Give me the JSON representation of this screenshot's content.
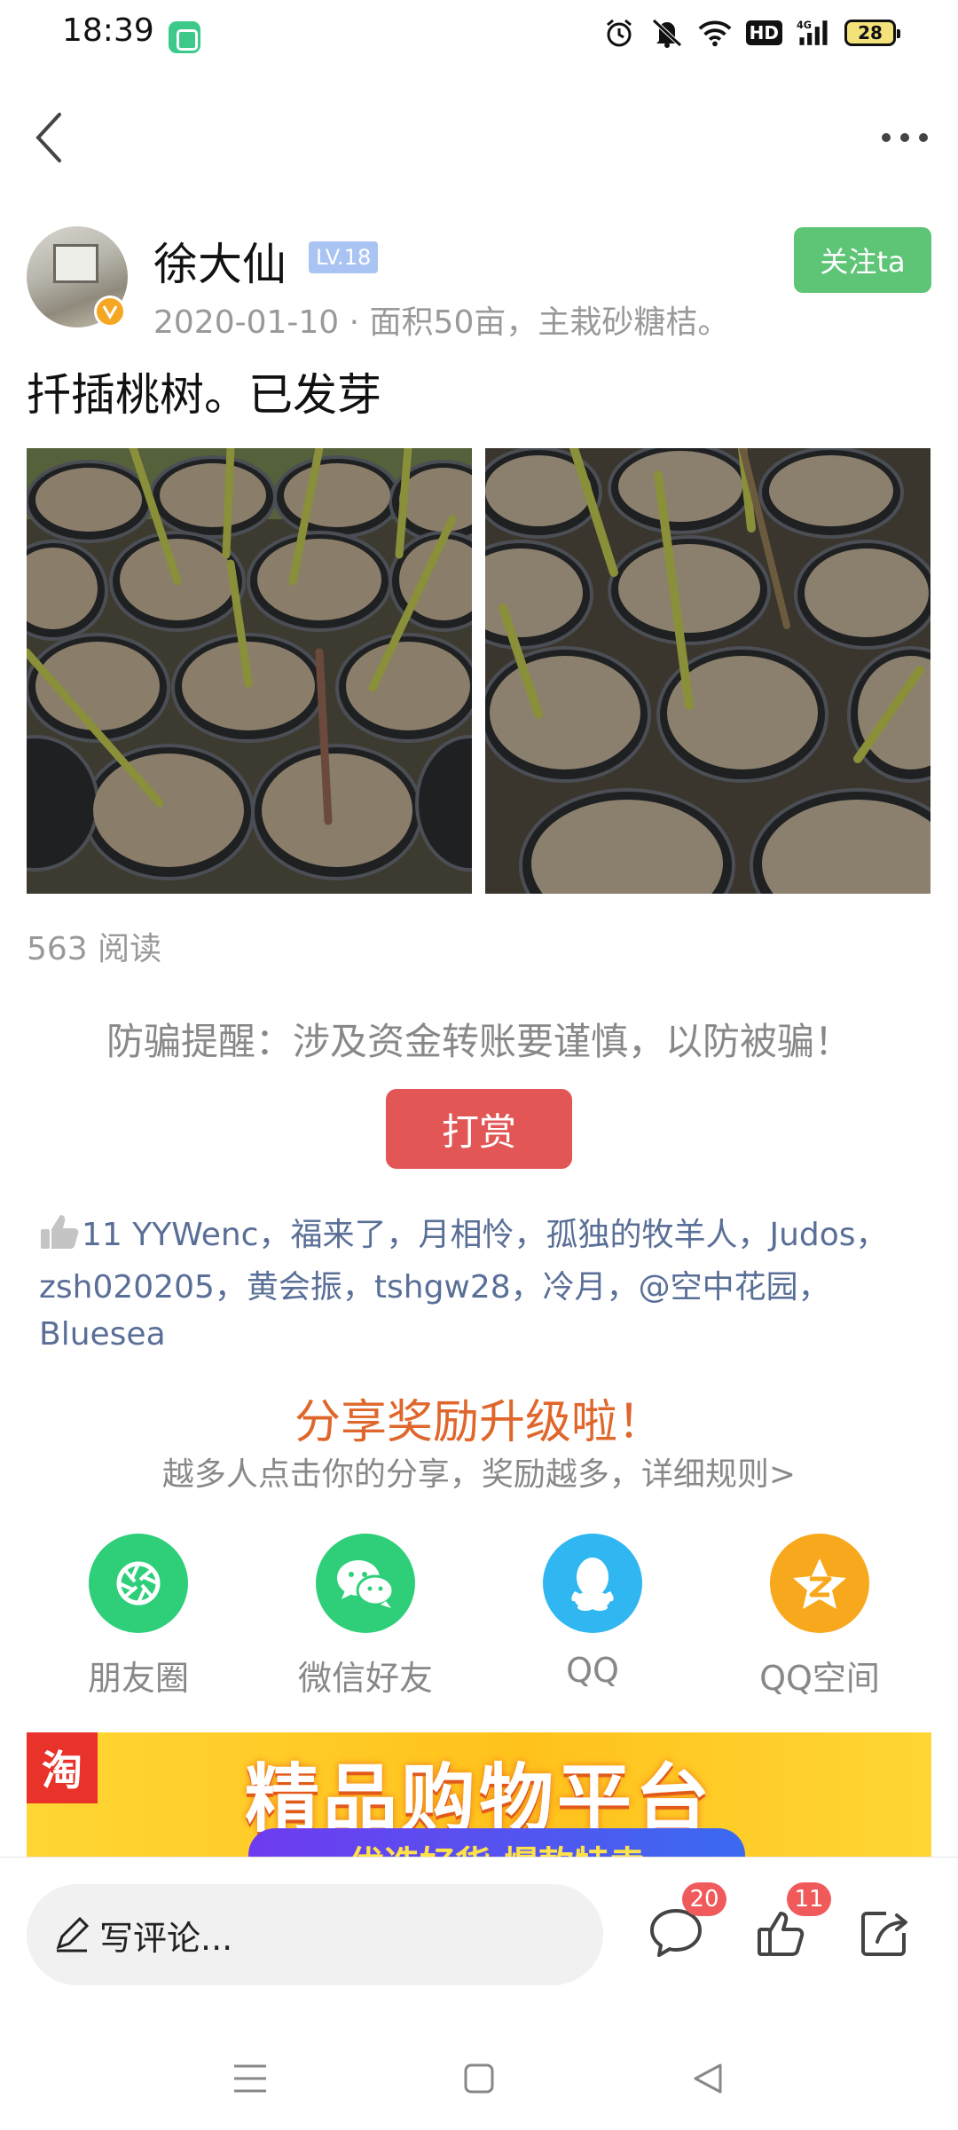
{
  "status_bar": {
    "time": "18:39",
    "hd_label": "HD",
    "network_label": "4G",
    "battery": "28"
  },
  "nav": {
    "back_icon": "chevron-left-icon",
    "more_icon": "more-horizontal-icon"
  },
  "author": {
    "name": "徐大仙",
    "level": "LV.18",
    "meta": "2020-01-10 · 面积50亩，主栽砂糖桔。",
    "follow_label": "关注ta"
  },
  "post": {
    "text": "扦插桃树。已发芽",
    "read_count": "563 阅读"
  },
  "fraud_tip": "防骗提醒：涉及资金转账要谨慎，以防被骗！",
  "reward_label": "打赏",
  "likes": {
    "text": "11 YYWenc，福来了，月相怜，孤独的牧羊人，Judos，zsh020205，黄会振，tshgw28，冷月，@空中花园，Bluesea"
  },
  "share": {
    "title": "分享奖励升级啦！",
    "subtitle": "越多人点击你的分享，奖励越多，详细规则>",
    "items": [
      {
        "label": "朋友圈",
        "color": "#2fcf7a",
        "icon": "moments-icon"
      },
      {
        "label": "微信好友",
        "color": "#2fcf7a",
        "icon": "wechat-icon"
      },
      {
        "label": "QQ",
        "color": "#30b6f0",
        "icon": "qq-icon"
      },
      {
        "label": "QQ空间",
        "color": "#f8a81c",
        "icon": "qzone-icon"
      }
    ]
  },
  "ad": {
    "logo": "淘",
    "headline": "精品购物平台",
    "sub": "优选好货 爆款特卖"
  },
  "bottom_bar": {
    "comment_placeholder": "写评论...",
    "comment_count": "20",
    "like_count": "11"
  },
  "colors": {
    "accent_green": "#5ec476",
    "reward_red": "#e25656",
    "link_blue": "#5a6f97",
    "share_orange": "#e0672c"
  }
}
